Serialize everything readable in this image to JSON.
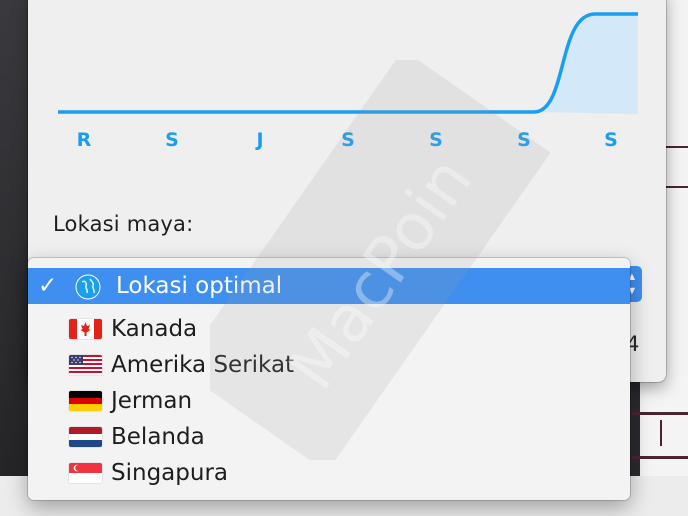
{
  "chart": {
    "axis_labels": [
      "R",
      "S",
      "J",
      "S",
      "S",
      "S",
      "S"
    ],
    "line_color": "#1a9ef0",
    "fill_color": "#cfe7f8",
    "values": [
      0,
      0,
      0,
      0,
      0,
      0,
      1
    ]
  },
  "location_panel": {
    "label": "Lokasi maya:",
    "partial_value": "4"
  },
  "menu": {
    "selected_index": 0,
    "items": [
      {
        "label": "Lokasi optimal",
        "icon": "globe-icon",
        "checked": true
      },
      {
        "label": "Kanada",
        "icon": "flag-canada-icon"
      },
      {
        "label": "Amerika Serikat",
        "icon": "flag-usa-icon"
      },
      {
        "label": "Jerman",
        "icon": "flag-germany-icon"
      },
      {
        "label": "Belanda",
        "icon": "flag-netherlands-icon"
      },
      {
        "label": "Singapura",
        "icon": "flag-singapore-icon"
      }
    ],
    "accent": "#3f8ff0"
  },
  "watermark": {
    "text": "MacPoin"
  }
}
